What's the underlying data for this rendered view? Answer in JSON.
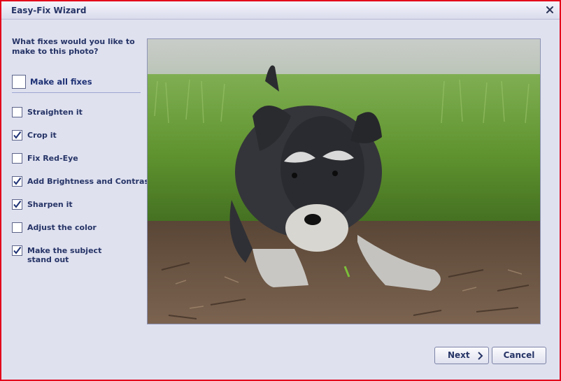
{
  "window": {
    "title": "Easy-Fix Wizard"
  },
  "prompt": "What fixes would you like to make to this photo?",
  "make_all": {
    "label": "Make all fixes",
    "checked": false
  },
  "options": [
    {
      "label": "Straighten it",
      "checked": false
    },
    {
      "label": "Crop it",
      "checked": true
    },
    {
      "label": "Fix Red-Eye",
      "checked": false
    },
    {
      "label": "Add Brightness and Contrast",
      "checked": true
    },
    {
      "label": "Sharpen it",
      "checked": true
    },
    {
      "label": "Adjust the color",
      "checked": false
    },
    {
      "label": "Make the subject\nstand out",
      "checked": true
    }
  ],
  "buttons": {
    "next": "Next",
    "cancel": "Cancel"
  },
  "colors": {
    "accent": "#263466",
    "frame_border": "#e3001b",
    "background": "#dfe1ef"
  }
}
